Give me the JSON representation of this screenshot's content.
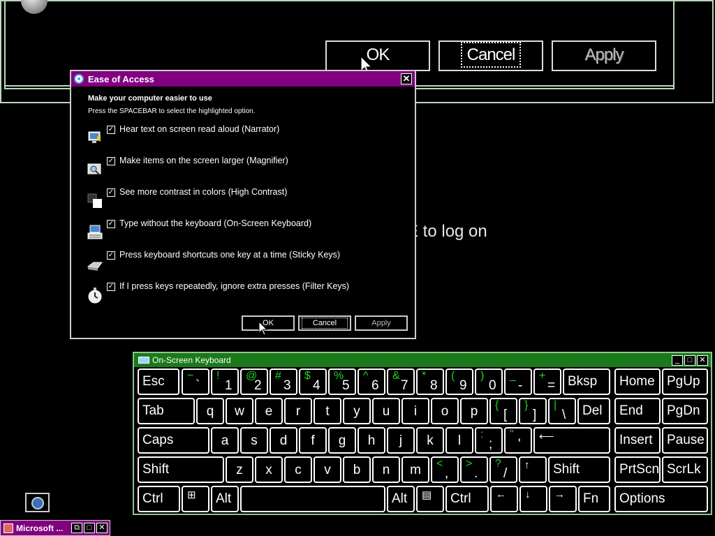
{
  "background_window": {
    "buttons": {
      "ok": "OK",
      "cancel": "Cancel",
      "apply": "Apply"
    },
    "logon_text": "E to log on"
  },
  "ease_dialog": {
    "title": "Ease of Access",
    "close": "✕",
    "heading": "Make your computer easier to use",
    "subheading": "Press the SPACEBAR to select the highlighted option.",
    "options": [
      {
        "label": "Hear text on screen read aloud (Narrator)",
        "checked": true,
        "icon": "narrator-icon"
      },
      {
        "label": "Make items on the screen larger (Magnifier)",
        "checked": true,
        "icon": "magnifier-icon"
      },
      {
        "label": "See more contrast in colors (High Contrast)",
        "checked": true,
        "icon": "high-contrast-icon"
      },
      {
        "label": "Type without the keyboard (On-Screen Keyboard)",
        "checked": true,
        "icon": "on-screen-keyboard-icon"
      },
      {
        "label": "Press keyboard shortcuts one key at a time (Sticky Keys)",
        "checked": true,
        "icon": "sticky-keys-icon"
      },
      {
        "label": "If I press keys repeatedly, ignore extra presses (Filter Keys)",
        "checked": true,
        "icon": "filter-keys-icon"
      }
    ],
    "check_glyph": "✓",
    "buttons": {
      "ok": "OK",
      "cancel": "Cancel",
      "apply": "Apply"
    }
  },
  "osk": {
    "title": "On-Screen Keyboard",
    "window_buttons": [
      "_",
      "□",
      "✕"
    ],
    "rows": [
      [
        {
          "label": "Esc",
          "name": "esc"
        },
        {
          "shift": "~",
          "base": "`",
          "name": "backtick"
        },
        {
          "shift": "!",
          "base": "1",
          "name": "1"
        },
        {
          "shift": "@",
          "base": "2",
          "name": "2"
        },
        {
          "shift": "#",
          "base": "3",
          "name": "3"
        },
        {
          "shift": "$",
          "base": "4",
          "name": "4"
        },
        {
          "shift": "%",
          "base": "5",
          "name": "5"
        },
        {
          "shift": "^",
          "base": "6",
          "name": "6"
        },
        {
          "shift": "&",
          "base": "7",
          "name": "7"
        },
        {
          "shift": "*",
          "base": "8",
          "name": "8"
        },
        {
          "shift": "(",
          "base": "9",
          "name": "9"
        },
        {
          "shift": ")",
          "base": "0",
          "name": "0"
        },
        {
          "shift": "_",
          "base": "-",
          "name": "minus"
        },
        {
          "shift": "+",
          "base": "=",
          "name": "equals"
        },
        {
          "label": "Bksp",
          "name": "backspace"
        },
        {
          "label": "Home",
          "name": "home"
        },
        {
          "label": "PgUp",
          "name": "pgup"
        }
      ],
      [
        {
          "label": "Tab",
          "name": "tab"
        },
        {
          "center": "q",
          "name": "q"
        },
        {
          "center": "w",
          "name": "w"
        },
        {
          "center": "e",
          "name": "e"
        },
        {
          "center": "r",
          "name": "r"
        },
        {
          "center": "t",
          "name": "t"
        },
        {
          "center": "y",
          "name": "y"
        },
        {
          "center": "u",
          "name": "u"
        },
        {
          "center": "i",
          "name": "i"
        },
        {
          "center": "o",
          "name": "o"
        },
        {
          "center": "p",
          "name": "p"
        },
        {
          "shift": "{",
          "base": "[",
          "name": "left-bracket"
        },
        {
          "shift": "}",
          "base": "]",
          "name": "right-bracket"
        },
        {
          "shift": "|",
          "base": "\\",
          "name": "backslash"
        },
        {
          "label": "Del",
          "name": "del"
        },
        {
          "label": "End",
          "name": "end"
        },
        {
          "label": "PgDn",
          "name": "pgdn"
        }
      ],
      [
        {
          "label": "Caps",
          "name": "caps"
        },
        {
          "center": "a",
          "name": "a"
        },
        {
          "center": "s",
          "name": "s"
        },
        {
          "center": "d",
          "name": "d"
        },
        {
          "center": "f",
          "name": "f"
        },
        {
          "center": "g",
          "name": "g"
        },
        {
          "center": "h",
          "name": "h"
        },
        {
          "center": "j",
          "name": "j"
        },
        {
          "center": "k",
          "name": "k"
        },
        {
          "center": "l",
          "name": "l"
        },
        {
          "shift": ":",
          "base": ";",
          "name": "semicolon"
        },
        {
          "shift": "\"",
          "base": "'",
          "name": "quote"
        },
        {
          "glyph": "⟵",
          "name": "enter"
        },
        {
          "label": "Insert",
          "name": "insert"
        },
        {
          "label": "Pause",
          "name": "pause"
        }
      ],
      [
        {
          "label": "Shift",
          "name": "shift-left"
        },
        {
          "center": "z",
          "name": "z"
        },
        {
          "center": "x",
          "name": "x"
        },
        {
          "center": "c",
          "name": "c"
        },
        {
          "center": "v",
          "name": "v"
        },
        {
          "center": "b",
          "name": "b"
        },
        {
          "center": "n",
          "name": "n"
        },
        {
          "center": "m",
          "name": "m"
        },
        {
          "shift": "<",
          "base": ",",
          "name": "comma"
        },
        {
          "shift": ">",
          "base": ".",
          "name": "period"
        },
        {
          "shift": "?",
          "base": "/",
          "name": "slash"
        },
        {
          "glyph": "↑",
          "name": "up"
        },
        {
          "label": "Shift",
          "name": "shift-right"
        },
        {
          "label": "PrtScn",
          "name": "prtscn"
        },
        {
          "label": "ScrLk",
          "name": "scrlk"
        }
      ],
      [
        {
          "label": "Ctrl",
          "name": "ctrl-left"
        },
        {
          "glyph": "⊞",
          "name": "windows"
        },
        {
          "label": "Alt",
          "name": "alt-left"
        },
        {
          "label": "",
          "name": "space"
        },
        {
          "label": "Alt",
          "name": "alt-right"
        },
        {
          "glyph": "▤",
          "name": "menu"
        },
        {
          "label": "Ctrl",
          "name": "ctrl-right"
        },
        {
          "glyph": "←",
          "name": "left"
        },
        {
          "glyph": "↓",
          "name": "down"
        },
        {
          "glyph": "→",
          "name": "right"
        },
        {
          "label": "Fn",
          "name": "fn"
        },
        {
          "label": "Options",
          "name": "options"
        }
      ]
    ]
  },
  "taskbar": {
    "item_title": "Microsoft ...",
    "item_buttons": [
      "⧉",
      "□",
      "✕"
    ]
  },
  "colors": {
    "dialog_title": "#800080",
    "osk_title": "#1a7a1a",
    "shift_char": "#1fd41f"
  }
}
